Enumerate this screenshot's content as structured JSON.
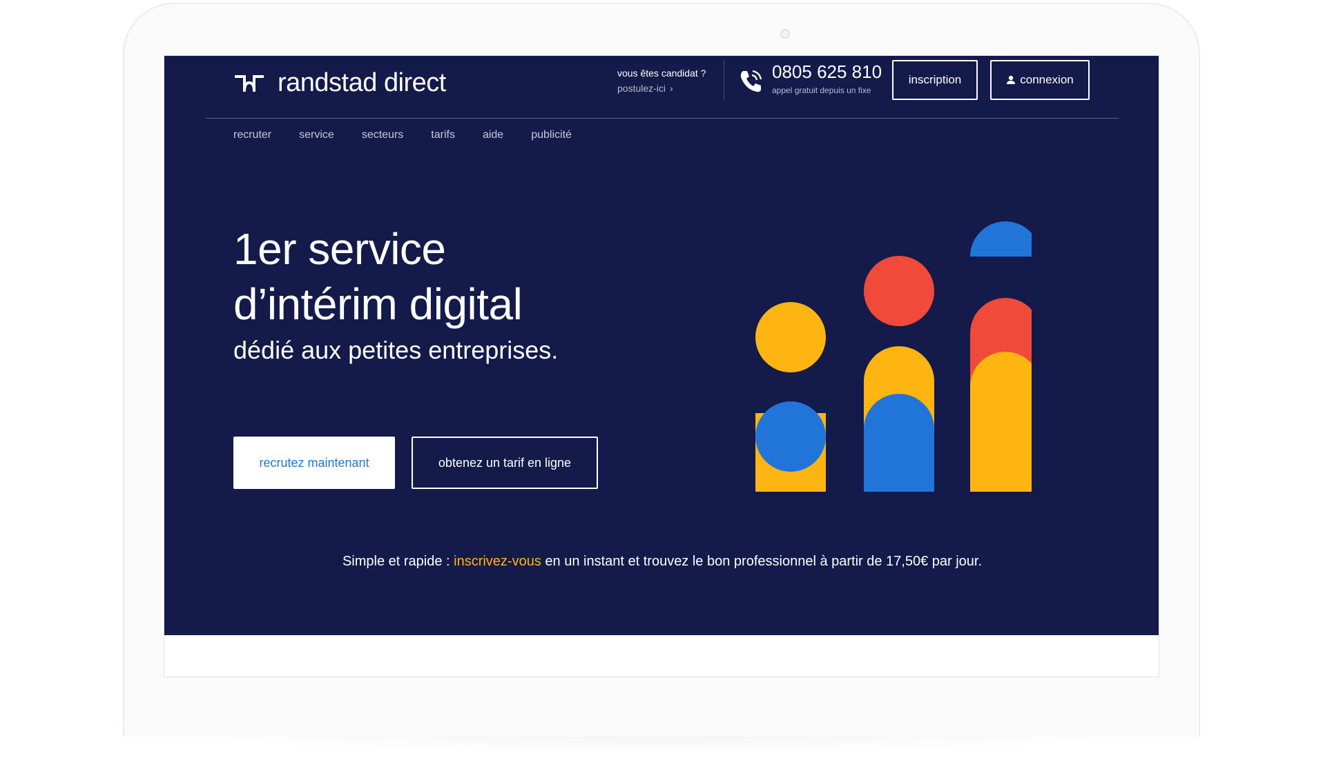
{
  "header": {
    "logo_text": "randstad direct",
    "candidate_question": "vous êtes candidat ?",
    "candidate_link": "postulez-ici",
    "phone_number": "0805 625 810",
    "phone_note": "appel gratuit depuis un fixe",
    "inscription_label": "inscription",
    "connexion_label": "connexion"
  },
  "nav": {
    "items": [
      "recruter",
      "service",
      "secteurs",
      "tarifs",
      "aide",
      "publicité"
    ]
  },
  "hero": {
    "title_line1": "1er service",
    "title_line2": "d’intérim digital",
    "subtitle": "dédié aux petites entreprises.",
    "primary_cta": "recrutez maintenant",
    "secondary_cta": "obtenez un tarif en ligne"
  },
  "tagline": {
    "before": "Simple et rapide : ",
    "link": "inscrivez-vous",
    "after": " en un instant et trouvez le bon professionnel à partir de 17,50€ par jour."
  },
  "colors": {
    "brand_navy": "#141a49",
    "accent_blue": "#2175d9",
    "accent_yellow": "#ffb511",
    "accent_red": "#f04a3a"
  }
}
